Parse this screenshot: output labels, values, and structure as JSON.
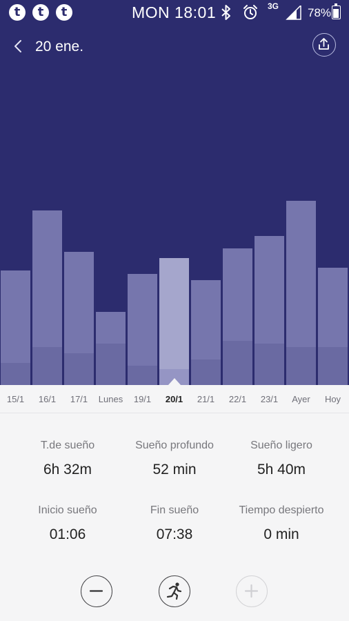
{
  "status_bar": {
    "notification_icons": [
      "t",
      "t",
      "t"
    ],
    "time": "MON 18:01",
    "network": "3G",
    "battery": "78%",
    "battery_level": 0.78
  },
  "header": {
    "title": "20 ene."
  },
  "chart_data": {
    "type": "bar",
    "categories": [
      "15/1",
      "16/1",
      "17/1",
      "Lunes",
      "19/1",
      "20/1",
      "21/1",
      "22/1",
      "23/1",
      "Ayer",
      "Hoy"
    ],
    "selected": "20/1",
    "series": [
      {
        "values": [
          0.36,
          0.55,
          0.42,
          0.23,
          0.35,
          0.4,
          0.33,
          0.43,
          0.47,
          0.58,
          0.37
        ]
      },
      {
        "values": [
          0.07,
          0.12,
          0.1,
          0.13,
          0.06,
          0.05,
          0.08,
          0.14,
          0.13,
          0.12,
          0.12
        ]
      }
    ],
    "ylim": [
      0,
      1
    ],
    "grid": false
  },
  "stats": {
    "total": {
      "label": "T.de sueño",
      "value": "6h 32m"
    },
    "deep": {
      "label": "Sueño profundo",
      "value": "52 min"
    },
    "light": {
      "label": "Sueño ligero",
      "value": "5h 40m"
    },
    "start": {
      "label": "Inicio sueño",
      "value": "01:06"
    },
    "end": {
      "label": "Fin sueño",
      "value": "07:38"
    },
    "awake": {
      "label": "Tiempo despierto",
      "value": "0 min"
    }
  },
  "icons": {
    "back": "chevron-left-icon",
    "share": "upload-icon",
    "minus": "minus-icon",
    "run": "running-person-icon",
    "plus": "plus-icon"
  },
  "colors": {
    "background": "#2c2c6e",
    "bar": "#7676ad",
    "bar_selected": "#a5a6cc"
  }
}
